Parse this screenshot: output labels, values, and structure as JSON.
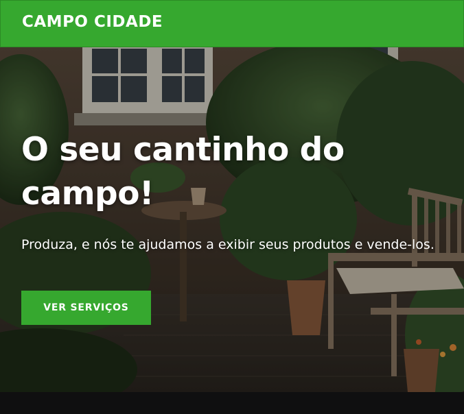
{
  "header": {
    "brand": "CAMPO CIDADE",
    "background_color": "#36a82f"
  },
  "hero": {
    "headline": "O seu cantinho do campo!",
    "subtitle": "Produza, e nós te ajudamos a exibir seus produtos e vende-los.",
    "cta_label": "VER SERVIÇOS",
    "cta_color": "#36a82f",
    "background_image": "garden-patio-photo"
  },
  "footer": {
    "background_color": "#0f0f10"
  }
}
